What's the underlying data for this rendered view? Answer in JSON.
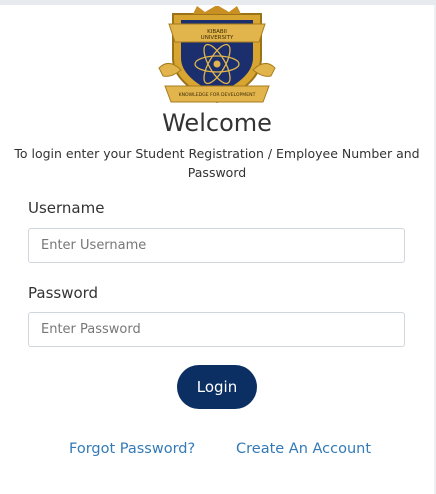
{
  "logo": {
    "icon": "university-crest-icon",
    "top_text": "KIBABII\nUNIVERSITY",
    "ribbon_text": "KNOWLEDGE FOR DEVELOPMENT"
  },
  "heading": {
    "title": "Welcome",
    "subtitle": "To login enter your Student Registration / Employee Number and Password"
  },
  "form": {
    "username_label": "Username",
    "username_placeholder": "Enter Username",
    "username_value": "",
    "password_label": "Password",
    "password_placeholder": "Enter Password",
    "password_value": "",
    "login_label": "Login"
  },
  "links": {
    "forgot": "Forgot Password?",
    "create": "Create An Account"
  },
  "colors": {
    "primary_button": "#0b2e63",
    "link": "#337ab7",
    "crest_gold": "#d8a531",
    "crest_navy": "#1b2f6e"
  }
}
